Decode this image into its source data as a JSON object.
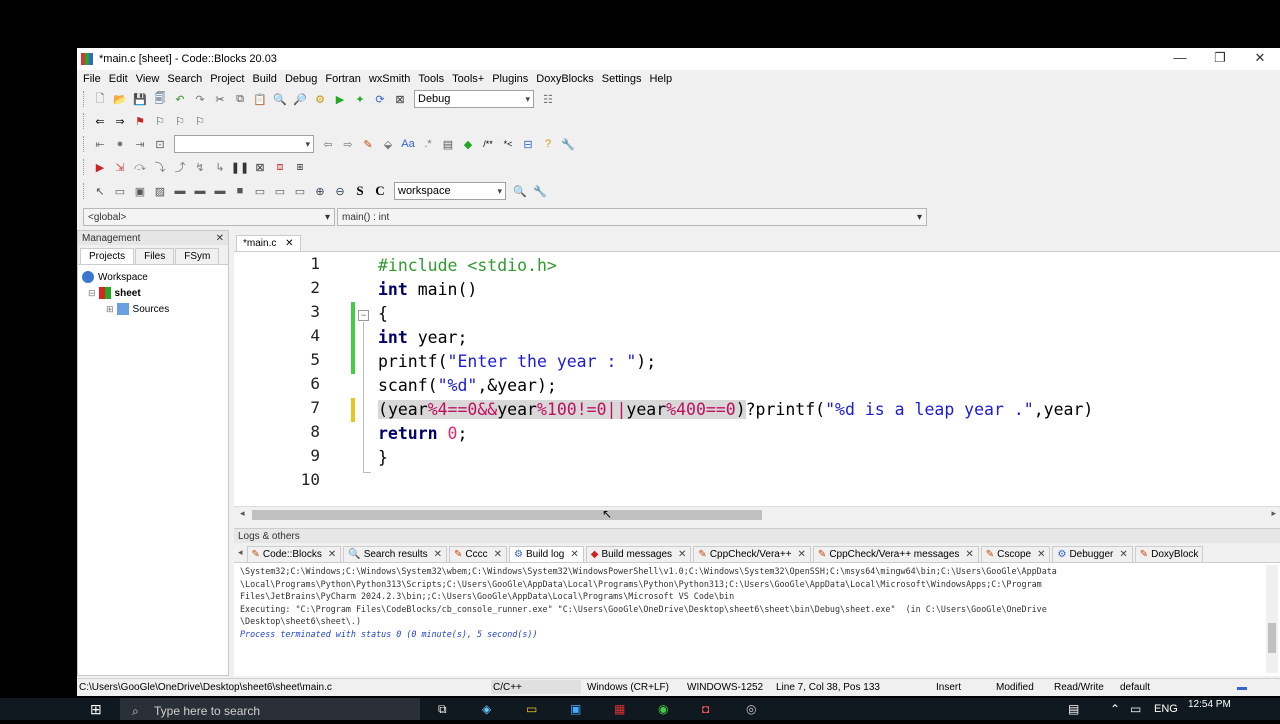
{
  "window": {
    "title": "*main.c [sheet] - Code::Blocks 20.03"
  },
  "menu": [
    "File",
    "Edit",
    "View",
    "Search",
    "Project",
    "Build",
    "Debug",
    "Fortran",
    "wxSmith",
    "Tools",
    "Tools+",
    "Plugins",
    "DoxyBlocks",
    "Settings",
    "Help"
  ],
  "toolbar": {
    "build_target": "Debug",
    "search_scope": "workspace",
    "empty_combo": ""
  },
  "scope_bar": {
    "scope": "<global>",
    "function": "main() : int"
  },
  "management": {
    "title": "Management",
    "tabs": [
      "Projects",
      "Files",
      "FSym"
    ],
    "tree": {
      "workspace": "Workspace",
      "project": "sheet",
      "folder": "Sources"
    }
  },
  "editor": {
    "tab": "*main.c",
    "line_numbers": [
      "1",
      "2",
      "3",
      "4",
      "5",
      "6",
      "7",
      "8",
      "9",
      "10"
    ],
    "lines": {
      "l1": "#include <stdio.h>",
      "l2_kw": "int",
      "l2_rest": " main()",
      "l3": "{",
      "l4_kw": "int",
      "l4_rest": " year;",
      "l5_a": "printf(",
      "l5_str": "\"Enter the year : \"",
      "l5_b": ");",
      "l6_a": "scanf(",
      "l6_str": "\"%d\"",
      "l6_b": ",&year);",
      "l7_p1": "(",
      "l7_a": "year",
      "l7_b": "%4==0&&",
      "l7_c": "year",
      "l7_d": "%100!=0||",
      "l7_e": "year",
      "l7_f": "%400==0",
      "l7_p2": ")",
      "l7_g": "?printf(",
      "l7_str": "\"%d is a leap year .\"",
      "l7_h": ",year)",
      "l8_kw": "return",
      "l8_num": " 0",
      "l8_rest": ";",
      "l9": "}",
      "l10": ""
    }
  },
  "logs": {
    "title": "Logs & others",
    "tabs": [
      "Code::Blocks",
      "Search results",
      "Cccc",
      "Build log",
      "Build messages",
      "CppCheck/Vera++",
      "CppCheck/Vera++ messages",
      "Cscope",
      "Debugger",
      "DoxyBlock"
    ],
    "active_tab": "Build log",
    "lines": [
      "\\System32;C:\\Windows;C:\\Windows\\System32\\wbem;C:\\Windows\\System32\\WindowsPowerShell\\v1.0;C:\\Windows\\System32\\OpenSSH;C:\\msys64\\mingw64\\bin;C:\\Users\\GooGle\\AppData",
      "\\Local\\Programs\\Python\\Python313\\Scripts;C:\\Users\\GooGle\\AppData\\Local\\Programs\\Python\\Python313;C:\\Users\\GooGle\\AppData\\Local\\Microsoft\\WindowsApps;C:\\Program",
      "Files\\JetBrains\\PyCharm 2024.2.3\\bin;;C:\\Users\\GooGle\\AppData\\Local\\Programs\\Microsoft VS Code\\bin",
      "Executing: \"C:\\Program Files\\CodeBlocks/cb_console_runner.exe\" \"C:\\Users\\GooGle\\OneDrive\\Desktop\\sheet6\\sheet\\bin\\Debug\\sheet.exe\"  (in C:\\Users\\GooGle\\OneDrive",
      "\\Desktop\\sheet6\\sheet\\.)"
    ],
    "terminated": "Process terminated with status 0 (0 minute(s), 5 second(s))"
  },
  "status": {
    "path": "C:\\Users\\GooGle\\OneDrive\\Desktop\\sheet6\\sheet\\main.c",
    "lang": "C/C++",
    "eol": "Windows (CR+LF)",
    "encoding": "WINDOWS-1252",
    "position": "Line 7, Col 38, Pos 133",
    "mode": "Insert",
    "modified": "Modified",
    "access": "Read/Write",
    "profile": "default"
  },
  "taskbar": {
    "search_placeholder": "Type here to search",
    "lang": "ENG",
    "time": "12:54 PM"
  }
}
